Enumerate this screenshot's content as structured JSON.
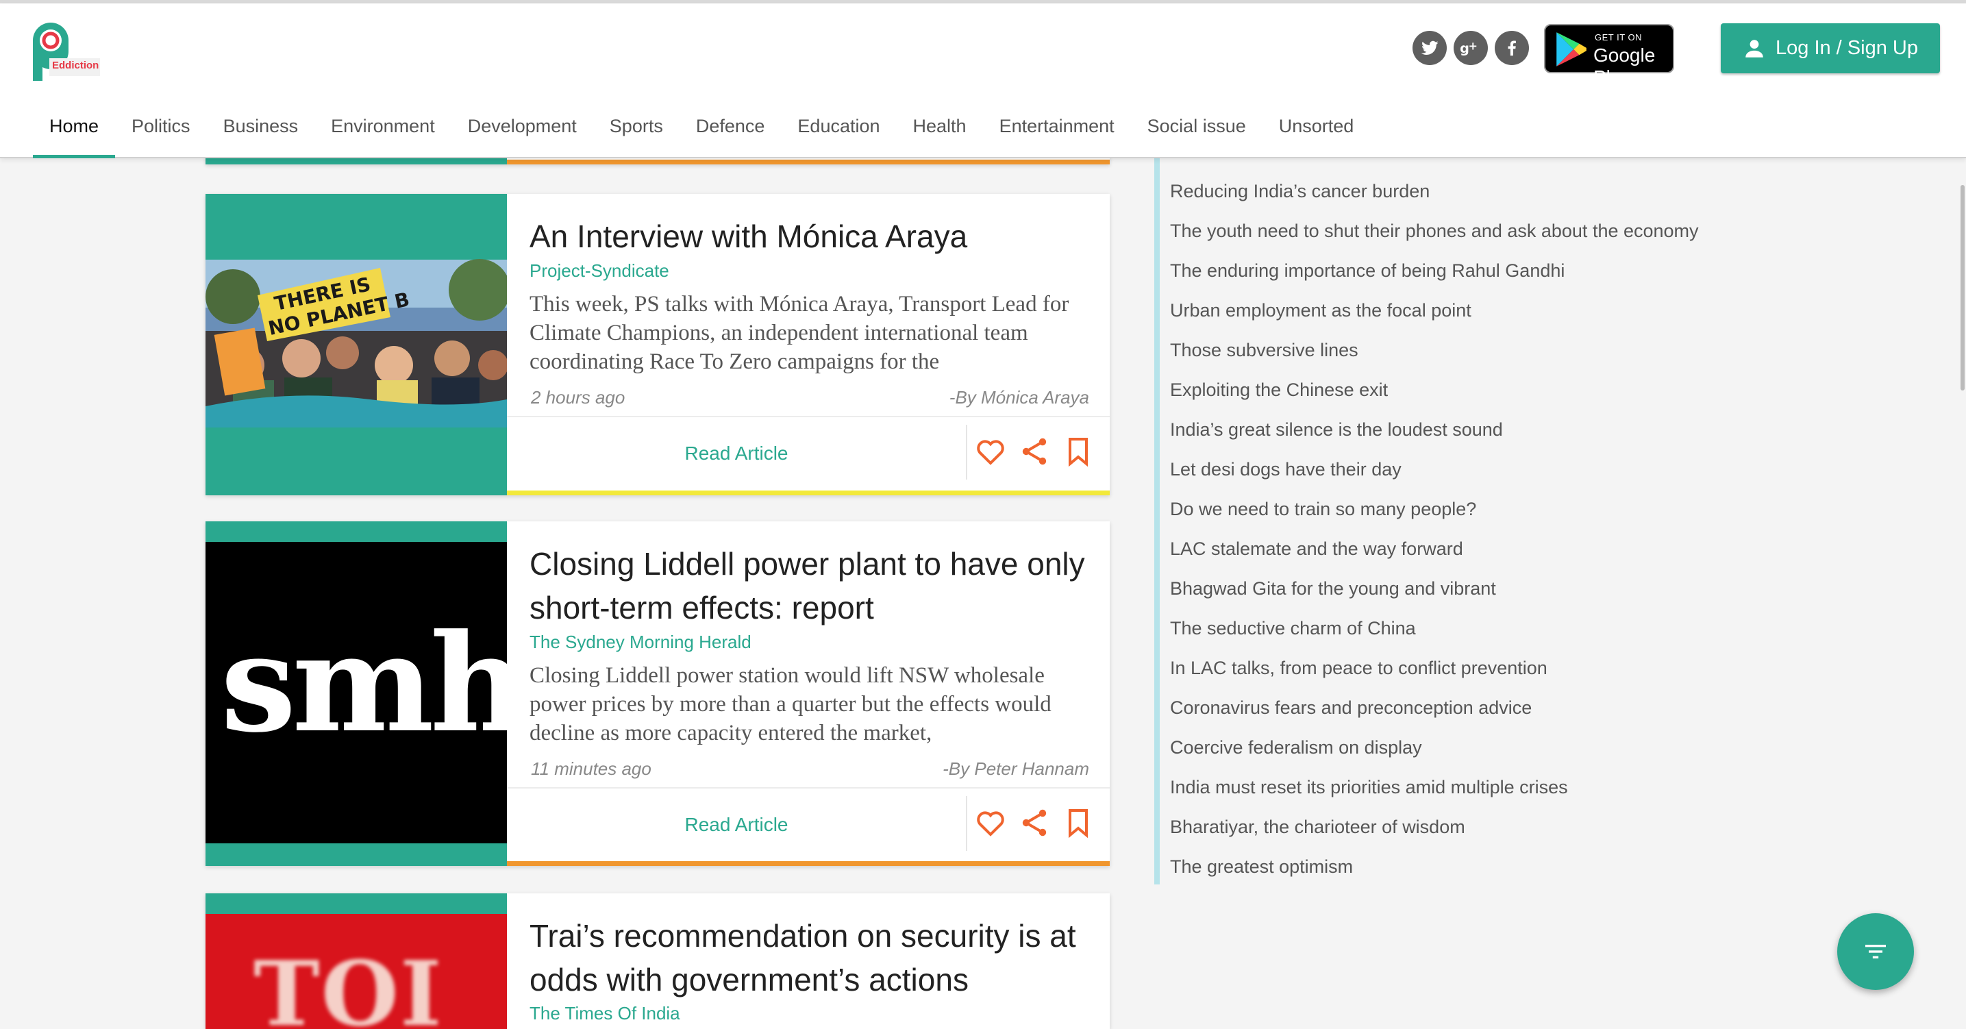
{
  "brand": {
    "logo_text": "Eddiction"
  },
  "header": {
    "google_play_small": "GET IT ON",
    "google_play_big": "Google Play",
    "login_label": "Log In / Sign Up"
  },
  "nav": [
    "Home",
    "Politics",
    "Business",
    "Environment",
    "Development",
    "Sports",
    "Defence",
    "Education",
    "Health",
    "Entertainment",
    "Social issue",
    "Unsorted"
  ],
  "articles": [
    {
      "title": "An Interview with Mónica Araya",
      "source": "Project-Syndicate",
      "summary": "This week, PS talks with Mónica Araya, Transport Lead for Climate Champions, an independent international team coordinating Race To Zero campaigns for the",
      "time": "2 hours ago",
      "author": "-By Mónica Araya",
      "read_label": "Read Article",
      "image_sign_line1": "THERE IS",
      "image_sign_line2": "NO PLANET B"
    },
    {
      "title": "Closing Liddell power plant to have only short-term effects: report",
      "source": "The Sydney Morning Herald",
      "summary": "Closing Liddell power station would lift NSW wholesale power prices by more than a quarter but the effects would decline as more capacity entered the market,",
      "time": "11 minutes ago",
      "author": "-By Peter Hannam",
      "read_label": "Read Article",
      "image_text": "smh"
    },
    {
      "title": "Trai’s recommendation on security is at odds with government’s actions",
      "source": "The Times Of India",
      "image_text": "TOI"
    }
  ],
  "sidebar_list": [
    "Reducing India’s cancer burden",
    "The youth need to shut their phones and ask about the economy",
    "The enduring importance of being Rahul Gandhi",
    "Urban employment as the focal point",
    "Those subversive lines",
    "Exploiting the Chinese exit",
    "India’s great silence is the loudest sound",
    "Let desi dogs have their day",
    "Do we need to train so many people?",
    "LAC stalemate and the way forward",
    "Bhagwad Gita for the young and vibrant",
    "The seductive charm of China",
    "In LAC talks, from peace to conflict prevention",
    "Coronavirus fears and preconception advice",
    "Coercive federalism on display",
    "India must reset its priorities amid multiple crises",
    "Bharatiyar, the charioteer of wisdom",
    "The greatest optimism"
  ],
  "colors": {
    "accent": "#2aa88f",
    "bar_orange": "#f0962e",
    "bar_yellow": "#f2e93a"
  }
}
